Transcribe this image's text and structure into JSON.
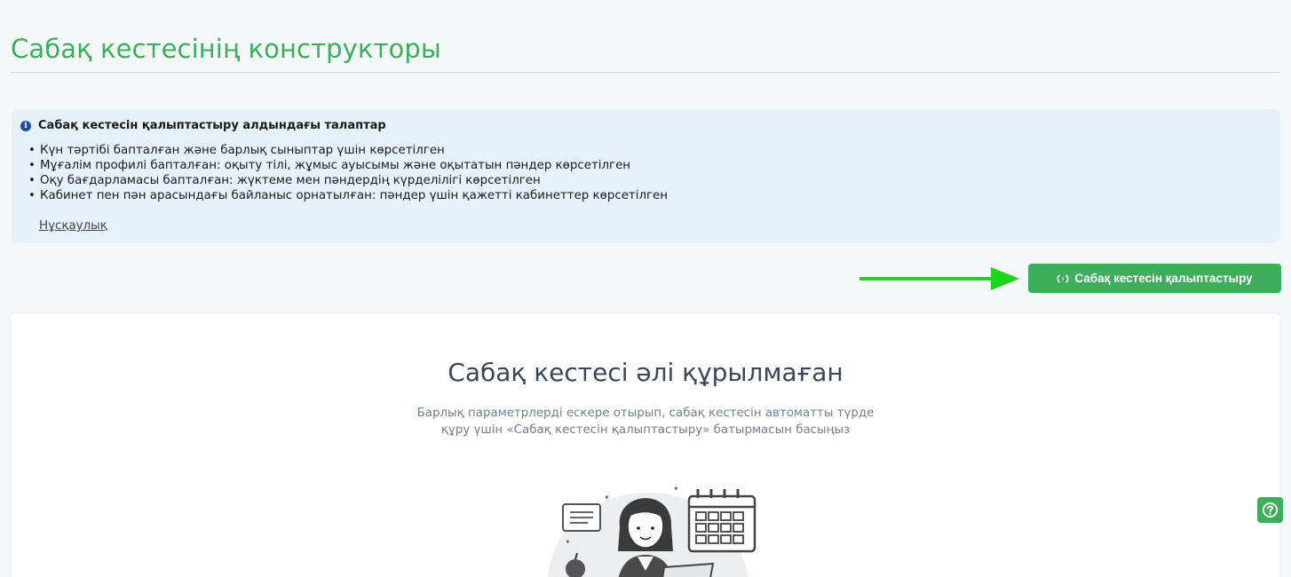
{
  "page": {
    "title": "Сабақ кестесінің конструкторы"
  },
  "requirements": {
    "title": "Сабақ кестесін қалыптастыру алдындағы талаптар",
    "items": [
      "Күн тәртібі бапталған және барлық сыныптар үшін көрсетілген",
      "Мұғалім профилі бапталған: оқыту тілі, жұмыс ауысымы және оқытатын пәндер көрсетілген",
      "Оқу бағдарламасы бапталған: жүктеме мен пәндердің күрделілігі көрсетілген",
      "Кабинет пен пән арасындағы байланыс орнатылған: пәндер үшін қажетті кабинеттер көрсетілген"
    ],
    "link_label": "Нұсқаулық"
  },
  "actions": {
    "generate_label": "Сабақ кестесін қалыптастыру"
  },
  "empty_state": {
    "title": "Сабақ кестесі әлі құрылмаған",
    "description_line1": "Барлық параметрлерді ескере отырып, сабақ кестесін автоматты түрде",
    "description_line2": "құру үшін «Сабақ кестесін қалыптастыру» батырмасын басыңыз"
  },
  "icons": {
    "info": "info-icon",
    "generate": "generate-icon",
    "help": "question-circle-icon",
    "arrow": "arrow-right-icon"
  },
  "colors": {
    "accent": "#3fae5c",
    "alert_bg": "#e6f2fb",
    "arrow": "#1fd21a",
    "title_text": "#3a4659"
  }
}
